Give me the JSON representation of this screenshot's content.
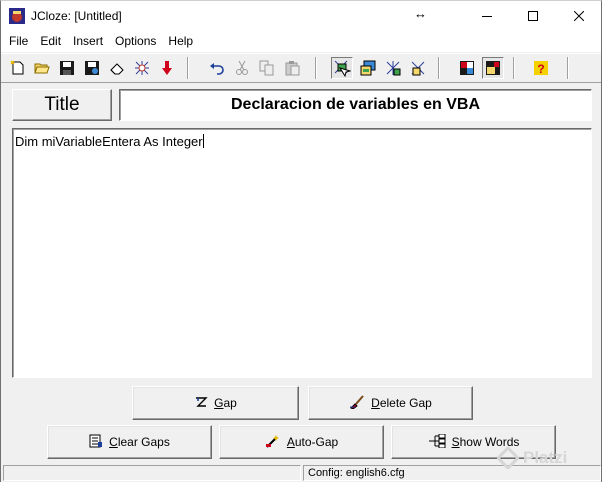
{
  "window": {
    "title": "JCloze: [Untitled]",
    "resize_glyph": "↔"
  },
  "menu": {
    "items": [
      "File",
      "Edit",
      "Insert",
      "Options",
      "Help"
    ]
  },
  "toolbar": {
    "icons": [
      "new-file-icon",
      "open-folder-icon",
      "save-icon",
      "save-as-webpage-icon",
      "eraser-icon",
      "network-icon",
      "red-down-arrow-icon",
      "undo-icon",
      "cut-icon",
      "copy-icon",
      "paste-icon",
      "create-webpage-icon",
      "export-java-icon",
      "tree-icon",
      "tree2-icon",
      "color-palette-icon",
      "config-icon",
      "help-icon"
    ]
  },
  "title_row": {
    "title_button": "Title",
    "title_value": "Declaracion de variables en VBA"
  },
  "editor": {
    "text": "Dim miVariableEntera As Integer"
  },
  "buttons": {
    "gap": {
      "prefix": "",
      "ul": "G",
      "rest": "ap"
    },
    "delete_gap": {
      "prefix": "",
      "ul": "D",
      "rest": "elete Gap"
    },
    "clear_gaps": {
      "prefix": "",
      "ul": "C",
      "rest": "lear Gaps"
    },
    "auto_gap": {
      "prefix": "",
      "ul": "A",
      "rest": "uto-Gap"
    },
    "show_words": {
      "prefix": "",
      "ul": "S",
      "rest": "how Words"
    }
  },
  "status": {
    "config": "Config: english6.cfg"
  },
  "watermark": "Platzi"
}
